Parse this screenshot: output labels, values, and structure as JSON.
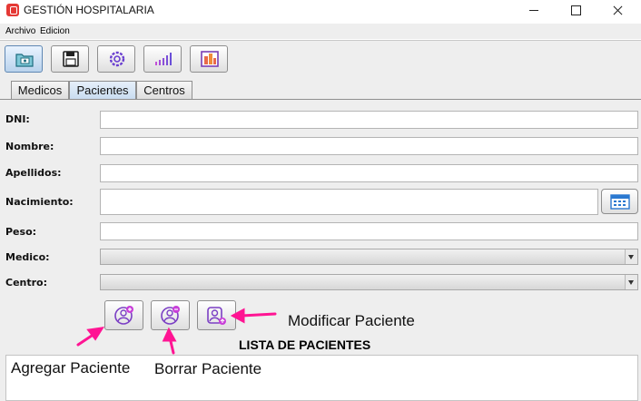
{
  "window": {
    "title": "GESTIÓN HOSPITALARIA"
  },
  "menu": {
    "items": [
      "Archivo",
      "Edicion"
    ]
  },
  "toolbar": {
    "buttons": [
      "folder-icon",
      "save-icon",
      "settings-icon",
      "bar-chart-icon",
      "report-icon"
    ]
  },
  "tabs": [
    {
      "label": "Medicos"
    },
    {
      "label": "Pacientes",
      "selected": true
    },
    {
      "label": "Centros"
    }
  ],
  "form": {
    "dni_label": "DNI:",
    "nombre_label": "Nombre:",
    "apellidos_label": "Apellidos:",
    "nacimiento_label": "Nacimiento:",
    "peso_label": "Peso:",
    "medico_label": "Medico:",
    "centro_label": "Centro:",
    "dni_value": "",
    "nombre_value": "",
    "apellidos_value": "",
    "nacimiento_value": "",
    "peso_value": "",
    "medico_value": "",
    "centro_value": ""
  },
  "actions": {
    "add_icon": "add-user-icon",
    "delete_icon": "remove-user-icon",
    "edit_icon": "edit-user-icon"
  },
  "list": {
    "title": "LISTA DE PACIENTES"
  },
  "annotations": {
    "add": "Agregar Paciente",
    "delete": "Borrar Paciente",
    "modify": "Modificar Paciente",
    "arrow_color": "#ff1493"
  },
  "colors": {
    "accent_icon": "#7b3fc4",
    "selected_tab": "#c9dcf0"
  }
}
